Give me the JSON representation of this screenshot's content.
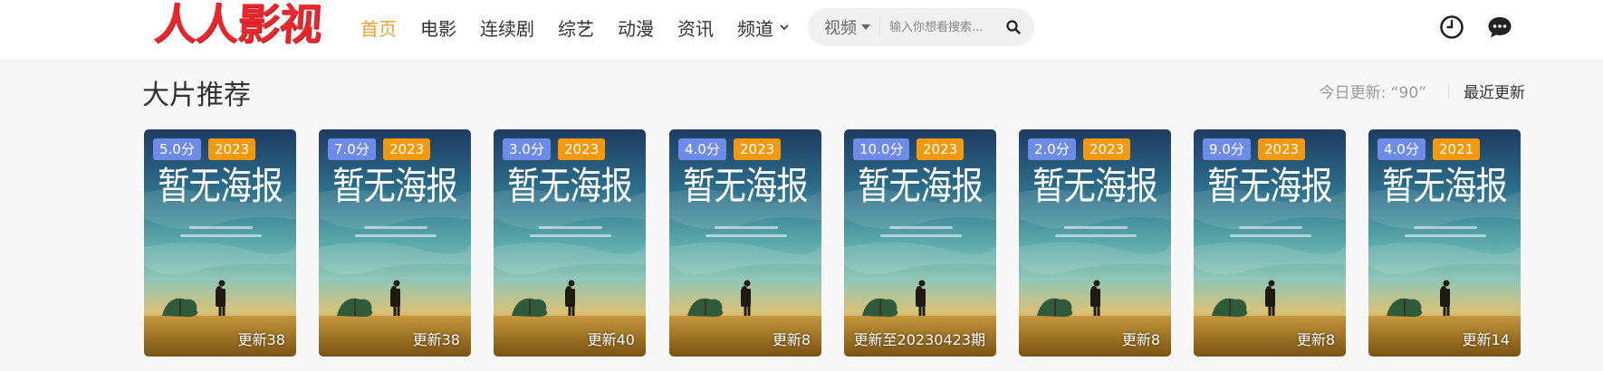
{
  "header": {
    "logo": "人人影视",
    "nav": [
      "首页",
      "电影",
      "连续剧",
      "综艺",
      "动漫",
      "资讯",
      "频道"
    ],
    "nav_active_index": 0,
    "search": {
      "category": "视频",
      "placeholder": "输入你想看搜索..."
    },
    "icons": [
      "clock-icon",
      "chat-icon",
      "search-icon",
      "chevron-down-icon"
    ]
  },
  "section": {
    "title": "大片推荐",
    "today_update": "今日更新: “90”",
    "recent": "最近更新"
  },
  "poster_text": "暂无海报",
  "cards": [
    {
      "score": "5.0分",
      "year": "2023",
      "update": "更新38"
    },
    {
      "score": "7.0分",
      "year": "2023",
      "update": "更新38"
    },
    {
      "score": "3.0分",
      "year": "2023",
      "update": "更新40"
    },
    {
      "score": "4.0分",
      "year": "2023",
      "update": "更新8"
    },
    {
      "score": "10.0分",
      "year": "2023",
      "update": "更新至20230423期"
    },
    {
      "score": "2.0分",
      "year": "2023",
      "update": "更新8"
    },
    {
      "score": "9.0分",
      "year": "2023",
      "update": "更新8"
    },
    {
      "score": "4.0分",
      "year": "2021",
      "update": "更新14"
    }
  ],
  "colors": {
    "logo": "#e8262d",
    "nav_active": "#e5a434",
    "score_badge": "#6f8be8",
    "year_badge": "#f2990e"
  }
}
